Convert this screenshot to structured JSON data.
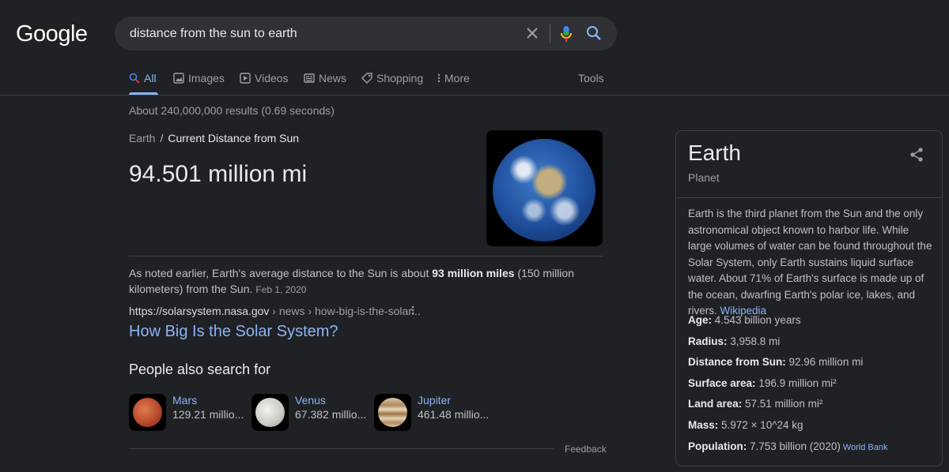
{
  "logo": "Google",
  "search": {
    "query": "distance from the sun to earth"
  },
  "tabs": [
    {
      "label": "All",
      "icon": "search-icon"
    },
    {
      "label": "Images",
      "icon": "image-icon"
    },
    {
      "label": "Videos",
      "icon": "video-icon"
    },
    {
      "label": "News",
      "icon": "news-icon"
    },
    {
      "label": "Shopping",
      "icon": "tag-icon"
    },
    {
      "label": "More",
      "icon": "more-vertical-icon"
    }
  ],
  "tools": "Tools",
  "stats": "About 240,000,000 results (0.69 seconds)",
  "answer": {
    "crumb_parent": "Earth",
    "crumb_sep": "/",
    "crumb_current": "Current Distance from Sun",
    "value": "94.501 million mi"
  },
  "result": {
    "snippet_pre": "As noted earlier, Earth's average distance to the Sun is about ",
    "snippet_bold": "93 million miles",
    "snippet_post": " (150 million kilometers) from the Sun.",
    "date": "Feb 1, 2020",
    "cite_domain": "https://solarsystem.nasa.gov",
    "cite_path": " › news › how-big-is-the-solar...",
    "title": "How Big Is the Solar System?"
  },
  "people_also_search": {
    "heading": "People also search for",
    "items": [
      {
        "name": "Mars",
        "value": "129.21 millio..."
      },
      {
        "name": "Venus",
        "value": "67.382 millio..."
      },
      {
        "name": "Jupiter",
        "value": "461.48 millio..."
      }
    ]
  },
  "feedback": "Feedback",
  "knowledge_panel": {
    "title": "Earth",
    "subtitle": "Planet",
    "description": "Earth is the third planet from the Sun and the only astronomical object known to harbor life. While large volumes of water can be found throughout the Solar System, only Earth sustains liquid surface water. About 71% of Earth's surface is made up of the ocean, dwarfing Earth's polar ice, lakes, and rivers. ",
    "description_link": "Wikipedia",
    "facts": [
      {
        "label": "Age:",
        "value": " 4.543 billion years"
      },
      {
        "label": "Radius:",
        "value": " 3,958.8 mi"
      },
      {
        "label": "Distance from Sun:",
        "value": " 92.96 million mi"
      },
      {
        "label": "Surface area:",
        "value": " 196.9 million mi²"
      },
      {
        "label": "Land area:",
        "value": " 57.51 million mi²"
      },
      {
        "label": "Mass:",
        "value": " 5.972 × 10^24 kg"
      },
      {
        "label": "Population:",
        "value": " 7.753 billion (2020)",
        "source": "World Bank"
      }
    ]
  },
  "colors": {
    "background": "#202124",
    "link": "#8ab4f8",
    "text": "#bdc1c6",
    "heading": "#e8eaed"
  }
}
